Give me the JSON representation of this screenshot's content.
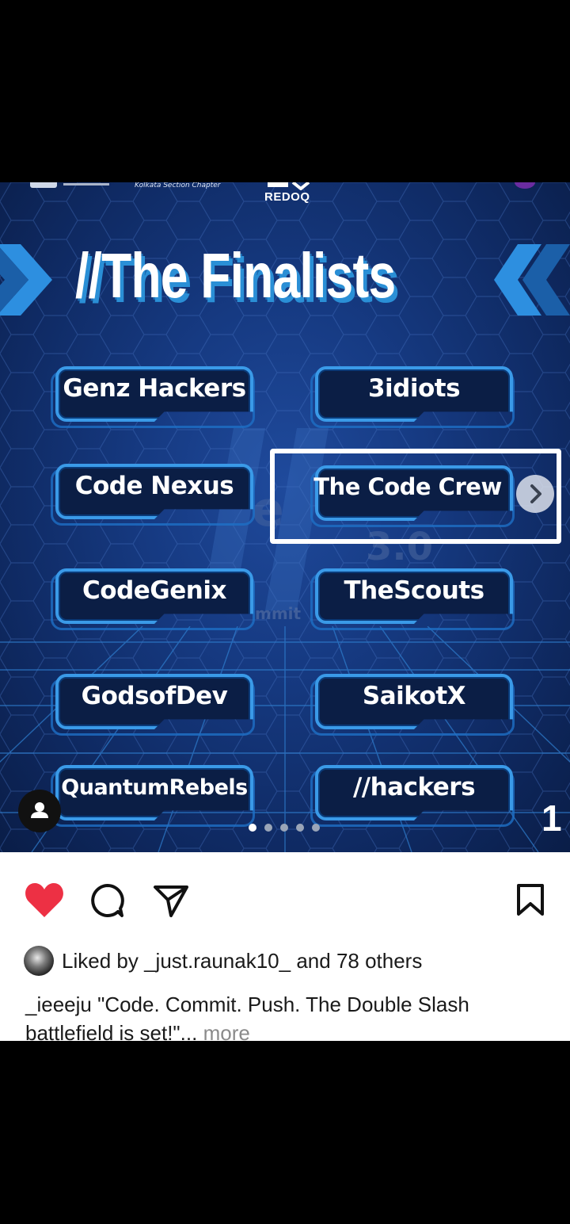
{
  "post": {
    "header_strip": {
      "chapter_text": "Kolkata Section Chapter",
      "brand": "REDOQ"
    },
    "title": "//The Finalists",
    "teams": [
      "Genz Hackers",
      "3idiots",
      "Code Nexus",
      "The Code Crew",
      "CodeGenix",
      "TheScouts",
      "GodsofDev",
      "SaikotX",
      "QuantumRebels",
      "//hackers"
    ],
    "ghost_text": {
      "version": "3.0",
      "fragment": "mmit",
      "logo_fragment": "e"
    },
    "highlighted_team": "The Code Crew",
    "slide_number": "1",
    "carousel": {
      "total_dots": 5,
      "active_index": 0
    }
  },
  "actions": {
    "like_icon": "heart-filled-icon",
    "comment_icon": "comment-icon",
    "share_icon": "send-icon",
    "save_icon": "bookmark-icon"
  },
  "likes": {
    "prefix": "Liked by ",
    "user": "_just.raunak10_",
    "middle": " and ",
    "count_text": "78 others"
  },
  "caption": {
    "username": "_ieeeju",
    "text": " \"Code. Commit. Push. The Double Slash battlefield is set!\"...",
    "more": "more"
  },
  "colors": {
    "like_red": "#ed3044",
    "accent_blue": "#3a9ae8",
    "background_navy": "#163a82"
  }
}
